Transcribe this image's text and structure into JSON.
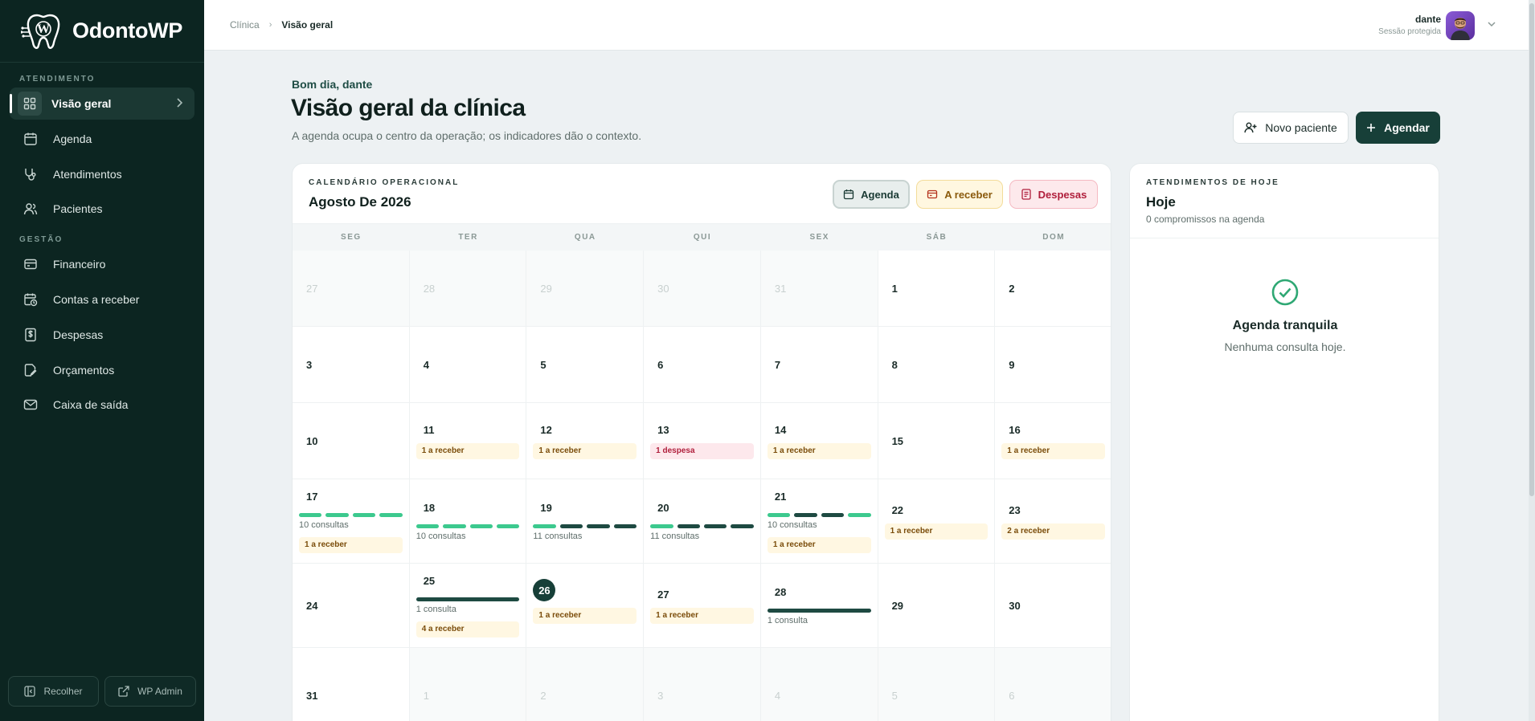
{
  "brand": {
    "name": "OdontoWP"
  },
  "sidebar": {
    "section_atendimento": "ATENDIMENTO",
    "section_gestao": "GESTÃO",
    "items": [
      {
        "label": "Visão geral",
        "icon": "grid-icon",
        "active": true
      },
      {
        "label": "Agenda",
        "icon": "calendar-icon"
      },
      {
        "label": "Atendimentos",
        "icon": "stethoscope-icon"
      },
      {
        "label": "Pacientes",
        "icon": "users-icon"
      },
      {
        "label": "Financeiro",
        "icon": "wallet-icon"
      },
      {
        "label": "Contas a receber",
        "icon": "calendar-clock-icon"
      },
      {
        "label": "Despesas",
        "icon": "dollar-receipt-icon"
      },
      {
        "label": "Orçamentos",
        "icon": "edit-document-icon"
      },
      {
        "label": "Caixa de saída",
        "icon": "mail-icon"
      }
    ],
    "collapse_label": "Recolher",
    "wp_admin_label": "WP Admin"
  },
  "topbar": {
    "breadcrumb_root": "Clínica",
    "breadcrumb_current": "Visão geral",
    "user_name": "dante",
    "user_status": "Sessão protegida"
  },
  "header": {
    "greeting": "Bom dia, dante",
    "title": "Visão geral da clínica",
    "subtitle": "A agenda ocupa o centro da operação; os indicadores dão o contexto.",
    "new_patient_label": "Novo paciente",
    "schedule_label": "Agendar"
  },
  "calendar": {
    "kicker": "CALENDÁRIO OPERACIONAL",
    "title": "Agosto De 2026",
    "chips": {
      "agenda": "Agenda",
      "receber": "A receber",
      "despesas": "Despesas"
    },
    "weekdays": [
      "SEG",
      "TER",
      "QUA",
      "QUI",
      "SEX",
      "SÁB",
      "DOM"
    ],
    "weeks": [
      [
        {
          "d": "27",
          "other": true
        },
        {
          "d": "28",
          "other": true
        },
        {
          "d": "29",
          "other": true
        },
        {
          "d": "30",
          "other": true
        },
        {
          "d": "31",
          "other": true
        },
        {
          "d": "1"
        },
        {
          "d": "2"
        }
      ],
      [
        {
          "d": "3"
        },
        {
          "d": "4"
        },
        {
          "d": "5"
        },
        {
          "d": "6"
        },
        {
          "d": "7"
        },
        {
          "d": "8"
        },
        {
          "d": "9"
        }
      ],
      [
        {
          "d": "10"
        },
        {
          "d": "11",
          "rec": "1 a receber"
        },
        {
          "d": "12",
          "rec": "1 a receber"
        },
        {
          "d": "13",
          "desp": "1 despesa"
        },
        {
          "d": "14",
          "rec": "1 a receber"
        },
        {
          "d": "15"
        },
        {
          "d": "16",
          "rec": "1 a receber"
        }
      ],
      [
        {
          "d": "17",
          "bars": [
            "g",
            "g",
            "g",
            "g"
          ],
          "cons": "10 consultas",
          "rec": "1 a receber"
        },
        {
          "d": "18",
          "bars": [
            "g",
            "g",
            "g",
            "g"
          ],
          "cons": "10 consultas"
        },
        {
          "d": "19",
          "bars": [
            "g",
            "d",
            "d",
            "d"
          ],
          "cons": "11 consultas"
        },
        {
          "d": "20",
          "bars": [
            "g",
            "d",
            "d",
            "d"
          ],
          "cons": "11 consultas"
        },
        {
          "d": "21",
          "bars": [
            "g",
            "d",
            "d",
            "g"
          ],
          "cons": "10 consultas",
          "rec": "1 a receber"
        },
        {
          "d": "22",
          "rec": "1 a receber"
        },
        {
          "d": "23",
          "rec": "2 a receber"
        }
      ],
      [
        {
          "d": "24"
        },
        {
          "d": "25",
          "bars": [
            "d"
          ],
          "cons": "1 consulta",
          "rec": "4 a receber"
        },
        {
          "d": "26",
          "today": true,
          "rec": "1 a receber"
        },
        {
          "d": "27",
          "rec": "1 a receber"
        },
        {
          "d": "28",
          "bars": [
            "d"
          ],
          "cons": "1 consulta"
        },
        {
          "d": "29"
        },
        {
          "d": "30"
        }
      ],
      [
        {
          "d": "31"
        },
        {
          "d": "1",
          "other": true
        },
        {
          "d": "2",
          "other": true
        },
        {
          "d": "3",
          "other": true
        },
        {
          "d": "4",
          "other": true
        },
        {
          "d": "5",
          "other": true
        },
        {
          "d": "6",
          "other": true
        }
      ]
    ]
  },
  "today": {
    "kicker": "ATENDIMENTOS DE HOJE",
    "title": "Hoje",
    "count": "0 compromissos na agenda",
    "empty_title": "Agenda tranquila",
    "empty_sub": "Nenhuma consulta hoje."
  },
  "colors": {
    "sidebar_bg": "#0c2521",
    "primary": "#173f38",
    "consult_green": "#3cc98e",
    "consult_dark": "#1e4a42",
    "receivable_bg": "#fff7e2",
    "expense_bg": "#fde8ec"
  }
}
